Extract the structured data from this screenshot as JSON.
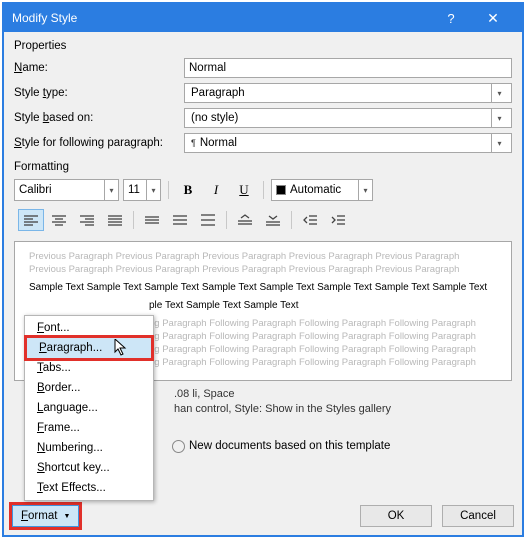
{
  "title": "Modify Style",
  "sections": {
    "properties": "Properties",
    "formatting": "Formatting"
  },
  "labels": {
    "name": "Name:",
    "style_type": "Style type:",
    "style_based_on": "Style based on:",
    "style_following": "Style for following paragraph:"
  },
  "fields": {
    "name": "Normal",
    "style_type": "Paragraph",
    "style_based_on": "(no style)",
    "style_following": "Normal"
  },
  "font": {
    "name": "Calibri",
    "size": "11",
    "color_label": "Automatic"
  },
  "toolbar": {
    "bold": "B",
    "italic": "I",
    "underline": "U"
  },
  "preview": {
    "ghost_prev": "Previous Paragraph Previous Paragraph Previous Paragraph Previous Paragraph Previous Paragraph Previous Paragraph Previous Paragraph Previous Paragraph Previous Paragraph Previous Paragraph",
    "sample1": "Sample Text Sample Text Sample Text Sample Text Sample Text Sample Text Sample Text Sample Text",
    "sample2": "ple Text Sample Text Sample Text",
    "ghost_next": "ng Paragraph Following Paragraph Following Paragraph Following Paragraph"
  },
  "description": {
    "line1": ".08 li, Space",
    "line2": "han control, Style: Show in the Styles gallery"
  },
  "radios": {
    "new_docs": "New documents based on this template"
  },
  "buttons": {
    "format": "Format",
    "ok": "OK",
    "cancel": "Cancel"
  },
  "menu": {
    "items": [
      {
        "label": "Font...",
        "name": "menu-font"
      },
      {
        "label": "Paragraph...",
        "name": "menu-paragraph",
        "highlight": true
      },
      {
        "label": "Tabs...",
        "name": "menu-tabs"
      },
      {
        "label": "Border...",
        "name": "menu-border"
      },
      {
        "label": "Language...",
        "name": "menu-language"
      },
      {
        "label": "Frame...",
        "name": "menu-frame"
      },
      {
        "label": "Numbering...",
        "name": "menu-numbering"
      },
      {
        "label": "Shortcut key...",
        "name": "menu-shortcut"
      },
      {
        "label": "Text Effects...",
        "name": "menu-text-effects"
      }
    ]
  }
}
